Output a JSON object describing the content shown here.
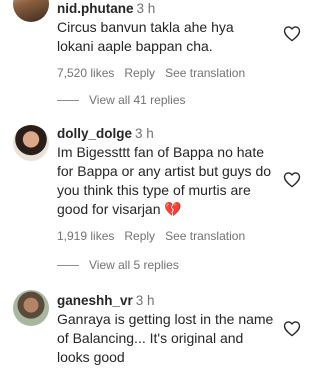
{
  "comments": [
    {
      "username": "nid.phutane",
      "time": "3 h",
      "text": "Circus banvun takla ahe hya lokani aaple bappan cha.",
      "likes": "7,520 likes",
      "reply_label": "Reply",
      "translate_label": "See translation",
      "view_replies": "View all 41 replies"
    },
    {
      "username": "dolly_dolge",
      "time": "3 h",
      "text": "Im Bigessttt fan of Bappa no hate for Bappa or any artist but guys do you think this type of murtis are good for visarjan",
      "emoji": "💔",
      "likes": "1,919 likes",
      "reply_label": "Reply",
      "translate_label": "See translation",
      "view_replies": "View all 5 replies"
    },
    {
      "username": "ganeshh_vr",
      "time": "3 h",
      "text": "Ganraya is getting lost in the name of Balancing... It's original and looks good"
    }
  ],
  "icons": {
    "like": "heart-outline",
    "avatar": "profile-photo"
  },
  "colors": {
    "text": "#262626",
    "secondary": "#737373",
    "heart_stroke": "#262626",
    "broken_heart": "#e0245e"
  }
}
